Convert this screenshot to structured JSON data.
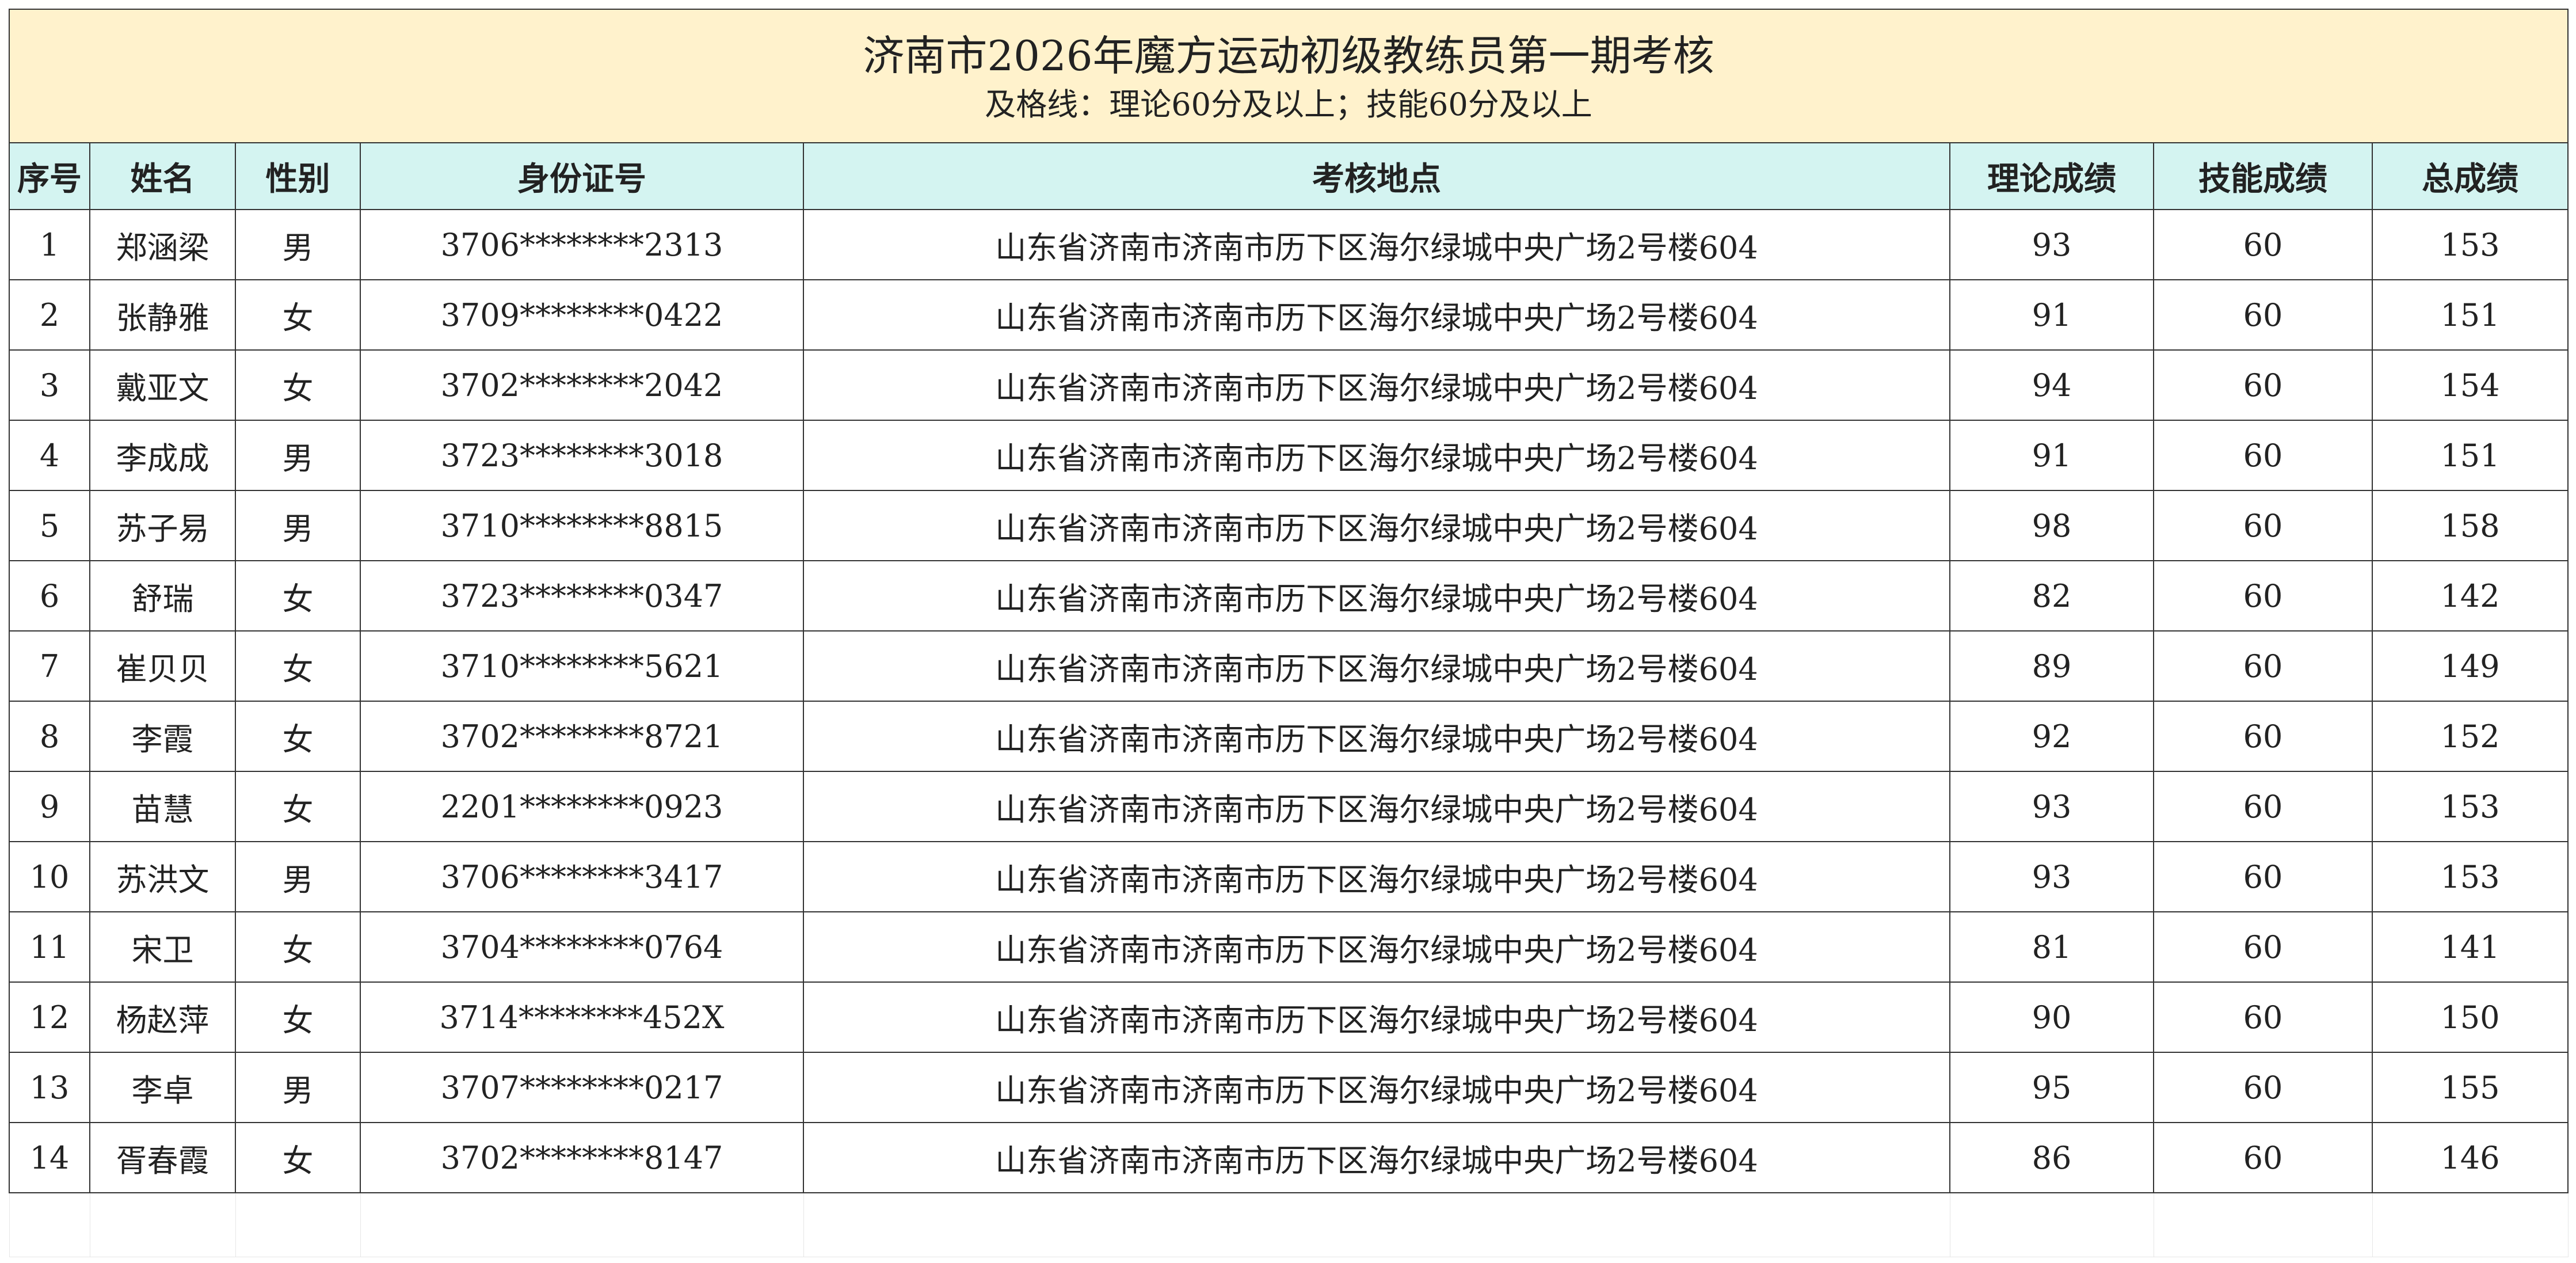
{
  "title": "济南市2026年魔方运动初级教练员第一期考核",
  "subtitle": "及格线：理论60分及以上；技能60分及以上",
  "columns": [
    "序号",
    "姓名",
    "性别",
    "身份证号",
    "考核地点",
    "理论成绩",
    "技能成绩",
    "总成绩"
  ],
  "rows": [
    [
      "1",
      "郑涵梁",
      "男",
      "3706********2313",
      "山东省济南市济南市历下区海尔绿城中央广场2号楼604",
      "93",
      "60",
      "153"
    ],
    [
      "2",
      "张静雅",
      "女",
      "3709********0422",
      "山东省济南市济南市历下区海尔绿城中央广场2号楼604",
      "91",
      "60",
      "151"
    ],
    [
      "3",
      "戴亚文",
      "女",
      "3702********2042",
      "山东省济南市济南市历下区海尔绿城中央广场2号楼604",
      "94",
      "60",
      "154"
    ],
    [
      "4",
      "李成成",
      "男",
      "3723********3018",
      "山东省济南市济南市历下区海尔绿城中央广场2号楼604",
      "91",
      "60",
      "151"
    ],
    [
      "5",
      "苏子易",
      "男",
      "3710********8815",
      "山东省济南市济南市历下区海尔绿城中央广场2号楼604",
      "98",
      "60",
      "158"
    ],
    [
      "6",
      "舒瑞",
      "女",
      "3723********0347",
      "山东省济南市济南市历下区海尔绿城中央广场2号楼604",
      "82",
      "60",
      "142"
    ],
    [
      "7",
      "崔贝贝",
      "女",
      "3710********5621",
      "山东省济南市济南市历下区海尔绿城中央广场2号楼604",
      "89",
      "60",
      "149"
    ],
    [
      "8",
      "李霞",
      "女",
      "3702********8721",
      "山东省济南市济南市历下区海尔绿城中央广场2号楼604",
      "92",
      "60",
      "152"
    ],
    [
      "9",
      "苗慧",
      "女",
      "2201********0923",
      "山东省济南市济南市历下区海尔绿城中央广场2号楼604",
      "93",
      "60",
      "153"
    ],
    [
      "10",
      "苏洪文",
      "男",
      "3706********3417",
      "山东省济南市济南市历下区海尔绿城中央广场2号楼604",
      "93",
      "60",
      "153"
    ],
    [
      "11",
      "宋卫",
      "女",
      "3704********0764",
      "山东省济南市济南市历下区海尔绿城中央广场2号楼604",
      "81",
      "60",
      "141"
    ],
    [
      "12",
      "杨赵萍",
      "女",
      "3714********452X",
      "山东省济南市济南市历下区海尔绿城中央广场2号楼604",
      "90",
      "60",
      "150"
    ],
    [
      "13",
      "李卓",
      "男",
      "3707********0217",
      "山东省济南市济南市历下区海尔绿城中央广场2号楼604",
      "95",
      "60",
      "155"
    ],
    [
      "14",
      "胥春霞",
      "女",
      "3702********8147",
      "山东省济南市济南市历下区海尔绿城中央广场2号楼604",
      "86",
      "60",
      "146"
    ]
  ],
  "colors": {
    "title_background": "#fff2cc",
    "header_background": "#d4f4f1",
    "border": "#333333"
  }
}
